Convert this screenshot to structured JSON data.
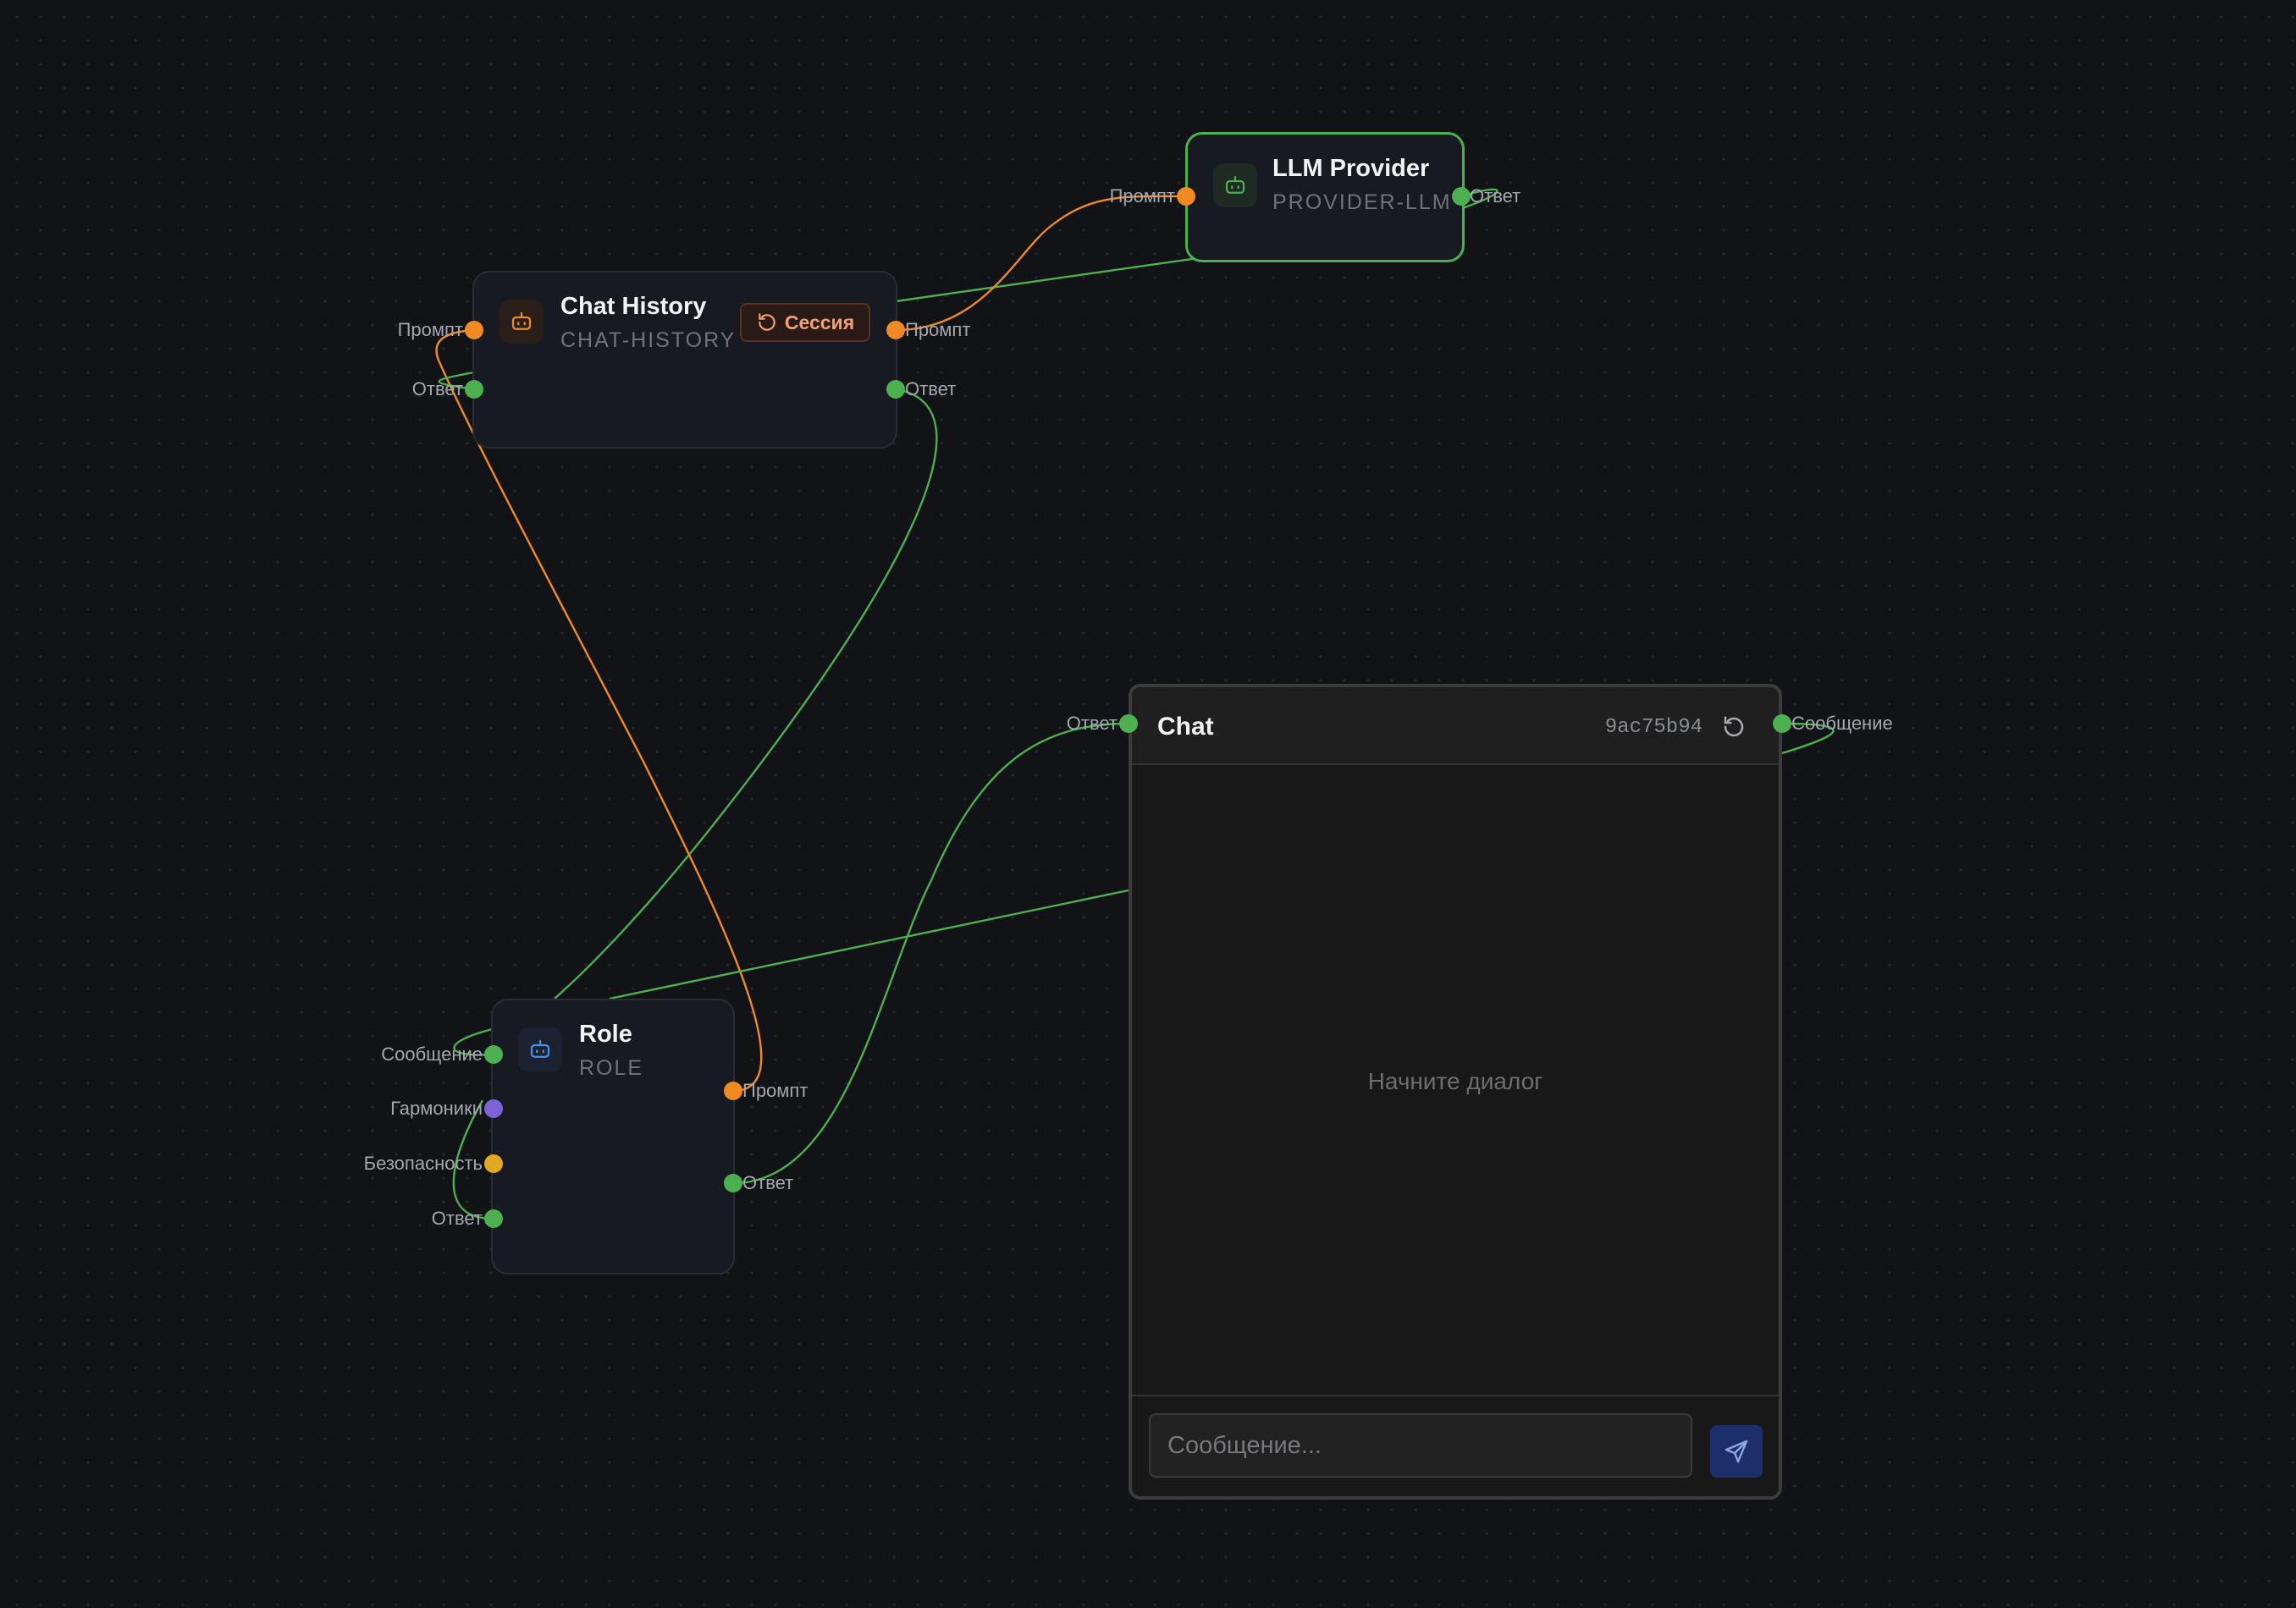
{
  "nodes": {
    "llm_provider": {
      "title": "LLM Provider",
      "subtitle": "PROVIDER-LLM",
      "icon": "bot-icon",
      "accent": "#4caf50",
      "ports": {
        "in_prompt": "Промпт",
        "out_response": "Ответ"
      }
    },
    "chat_history": {
      "title": "Chat History",
      "subtitle": "CHAT-HISTORY",
      "icon": "bot-icon",
      "accent": "#f08a24",
      "session_button": "Сессия",
      "ports": {
        "in_prompt": "Промпт",
        "in_response": "Ответ",
        "out_prompt": "Промпт",
        "out_response": "Ответ"
      }
    },
    "role": {
      "title": "Role",
      "subtitle": "ROLE",
      "icon": "bot-icon",
      "accent": "#4a8fe0",
      "ports": {
        "in_message": "Сообщение",
        "in_harmony": "Гармоники",
        "in_safety": "Безопасность",
        "in_response": "Ответ",
        "out_prompt": "Промпт",
        "out_response": "Ответ"
      }
    }
  },
  "chat": {
    "title": "Chat",
    "session_id": "9ac75b94",
    "empty_text": "Начните диалог",
    "input_placeholder": "Сообщение...",
    "ports": {
      "in_response": "Ответ",
      "out_message": "Сообщение"
    }
  },
  "colors": {
    "background": "#111317",
    "wire_green": "#4caf50",
    "wire_orange": "#f08a24",
    "port_purple": "#7e63d6",
    "port_yellow": "#e2a823"
  }
}
